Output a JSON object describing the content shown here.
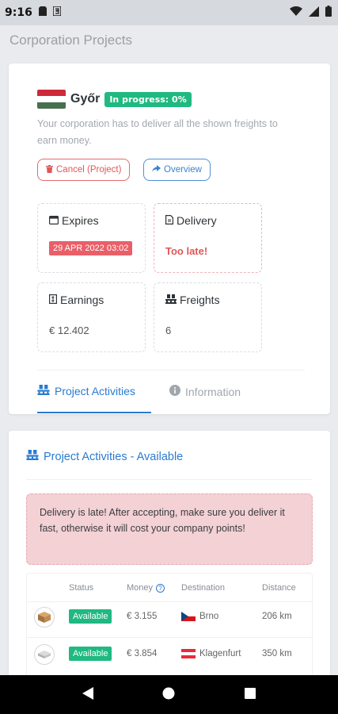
{
  "status_bar": {
    "time": "9:16"
  },
  "page_title": "Corporation Projects",
  "project": {
    "city": "Győr",
    "progress_label": "In progress: 0%",
    "description": "Your corporation has to deliver all the shown freights to earn money.",
    "cancel_label": "Cancel (Project)",
    "overview_label": "Overview"
  },
  "stats": {
    "expires_label": "Expires",
    "expires_value": "29 APR 2022 03:02",
    "delivery_label": "Delivery",
    "delivery_value": "Too late!",
    "earnings_label": "Earnings",
    "earnings_value": "€ 12.402",
    "freights_label": "Freights",
    "freights_value": "6"
  },
  "tabs": {
    "activities": "Project Activities",
    "information": "Information"
  },
  "section": {
    "title": "Project Activities - Available",
    "alert": "Delivery is late! After accepting, make sure you deliver it fast, otherwise it will cost your company points!"
  },
  "table": {
    "headers": {
      "status": "Status",
      "money": "Money",
      "destination": "Destination",
      "distance": "Distance"
    },
    "rows": [
      {
        "status": "Available",
        "money": "€ 3.155",
        "destination": "Brno",
        "distance": "206 km",
        "flag": "cz"
      },
      {
        "status": "Available",
        "money": "€ 3.854",
        "destination": "Klagenfurt",
        "distance": "350 km",
        "flag": "at"
      }
    ]
  },
  "colors": {
    "accent": "#2b7bd0",
    "success": "#1fb981",
    "danger": "#e95f68"
  }
}
